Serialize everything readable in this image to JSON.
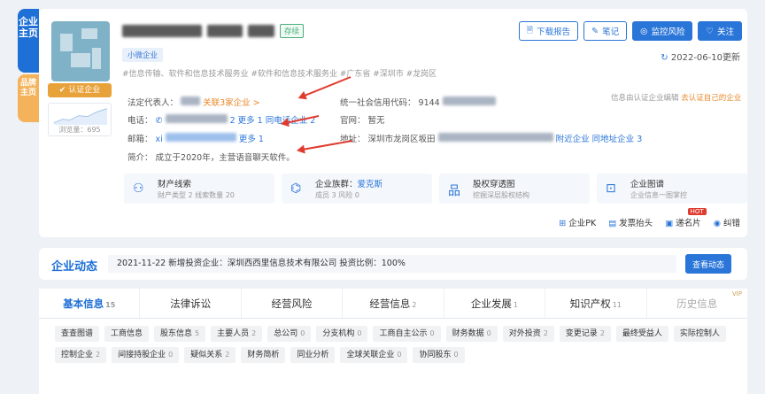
{
  "side": {
    "main": "企业主页",
    "brand": "品牌主页"
  },
  "company": {
    "status": "存续",
    "size_tag": "小微企业",
    "cert": "认证企业",
    "views": "浏览量：695",
    "tags": "#信息传输、软件和信息技术服务业 #软件和信息技术服务业 #广东省 #深圳市 #龙岗区",
    "update": "2022-06-10更新"
  },
  "buttons": [
    "下载报告",
    "笔记",
    "监控风险",
    "关注"
  ],
  "info": {
    "legal_label": "法定代表人：",
    "related": "关联3家企业 >",
    "credit_label": "统一社会信用代码：",
    "credit_prefix": "9144",
    "claim_note": "信息由认证企业编辑",
    "claim_link": "去认证自己的企业",
    "phone_label": "电话：",
    "phone_digit": "2",
    "phone_more": "更多 1",
    "phone_same": "同电话企业 2",
    "site_label": "官网：",
    "site_value": "暂无",
    "email_label": "邮箱：",
    "email_prefix": "xi",
    "email_more": "更多 1",
    "addr_label": "地址：",
    "addr_value": "深圳市龙岗区坂田",
    "addr_near": "附近企业",
    "addr_same": "同地址企业 3",
    "intro_label": "简介：",
    "intro_value": "成立于2020年，主营语音聊天软件。"
  },
  "features": [
    {
      "icon": "⚇",
      "title": "财产线索",
      "sub": "财产类型 2  线索数量 20"
    },
    {
      "icon": "⌬",
      "title": "企业族群：",
      "title_link": "爱克斯",
      "sub": "成员 3  风险 0"
    },
    {
      "icon": "品",
      "title": "股权穿透图",
      "sub": "挖掘深层股权结构"
    },
    {
      "icon": "⊡",
      "title": "企业图谱",
      "sub": "企业信息一图掌控"
    }
  ],
  "tools": [
    "企业PK",
    "发票抬头",
    "递名片",
    "纠错"
  ],
  "hot": "HOT",
  "news": {
    "label": "企业动态",
    "text": "2021-11-22 新增投资企业：深圳西西里信息技术有限公司 投资比例：100%",
    "button": "查看动态"
  },
  "tabs": [
    {
      "label": "基本信息",
      "count": "15"
    },
    {
      "label": "法律诉讼",
      "count": ""
    },
    {
      "label": "经营风险",
      "count": ""
    },
    {
      "label": "经营信息",
      "count": "2"
    },
    {
      "label": "企业发展",
      "count": "1"
    },
    {
      "label": "知识产权",
      "count": "11"
    },
    {
      "label": "历史信息",
      "count": ""
    }
  ],
  "vip": "VIP",
  "chips": [
    {
      "label": "查查图谱",
      "count": ""
    },
    {
      "label": "工商信息",
      "count": ""
    },
    {
      "label": "股东信息",
      "count": "5"
    },
    {
      "label": "主要人员",
      "count": "2"
    },
    {
      "label": "总公司",
      "count": "0"
    },
    {
      "label": "分支机构",
      "count": "0"
    },
    {
      "label": "工商自主公示",
      "count": "0"
    },
    {
      "label": "财务数据",
      "count": "0"
    },
    {
      "label": "对外投资",
      "count": "2"
    },
    {
      "label": "变更记录",
      "count": "2"
    },
    {
      "label": "最终受益人",
      "count": ""
    },
    {
      "label": "实际控制人",
      "count": ""
    },
    {
      "label": "控制企业",
      "count": "2"
    },
    {
      "label": "间接持股企业",
      "count": "0"
    },
    {
      "label": "疑似关系",
      "count": "2"
    },
    {
      "label": "财务简析",
      "count": ""
    },
    {
      "label": "同业分析",
      "count": ""
    },
    {
      "label": "全球关联企业",
      "count": "0"
    },
    {
      "label": "协同股东",
      "count": "0"
    }
  ],
  "colors": {
    "primary": "#2a75d8",
    "arrow": "#e03b2f",
    "cert": "#e8a23a"
  }
}
